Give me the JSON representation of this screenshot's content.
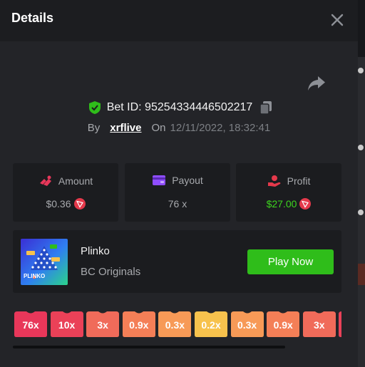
{
  "modal": {
    "title": "Details"
  },
  "bet": {
    "id_text": "Bet ID: 95254334446502217",
    "by_label": "By",
    "username": "xrflive",
    "on_label": "On",
    "datetime": "12/11/2022, 18:32:41"
  },
  "stats": [
    {
      "label": "Amount",
      "value": "$0.36",
      "icon": "amount-icon",
      "color": "#e8375a"
    },
    {
      "label": "Payout",
      "value": "76 x",
      "icon": "wallet-icon",
      "color": "#8f4dff"
    },
    {
      "label": "Profit",
      "value": "$27.00",
      "icon": "profit-icon",
      "color": "#e5394b"
    }
  ],
  "game": {
    "name": "Plinko",
    "provider": "BC Originals",
    "play_label": "Play Now",
    "thumb_caption": "PLINKO"
  },
  "multipliers": [
    {
      "label": "76x",
      "color": "#e8375a"
    },
    {
      "label": "10x",
      "color": "#ea4158"
    },
    {
      "label": "3x",
      "color": "#f06b5a"
    },
    {
      "label": "0.9x",
      "color": "#f47f57"
    },
    {
      "label": "0.3x",
      "color": "#f79a57"
    },
    {
      "label": "0.2x",
      "color": "#f7c24d"
    },
    {
      "label": "0.3x",
      "color": "#f79a57"
    },
    {
      "label": "0.9x",
      "color": "#f47f57"
    },
    {
      "label": "3x",
      "color": "#f06b5a"
    },
    {
      "label": "",
      "color": "#ea4158"
    }
  ],
  "colors": {
    "accent_green": "#2fbd1a",
    "profit_green": "#3dd51f",
    "trx_red": "#e5394b"
  }
}
